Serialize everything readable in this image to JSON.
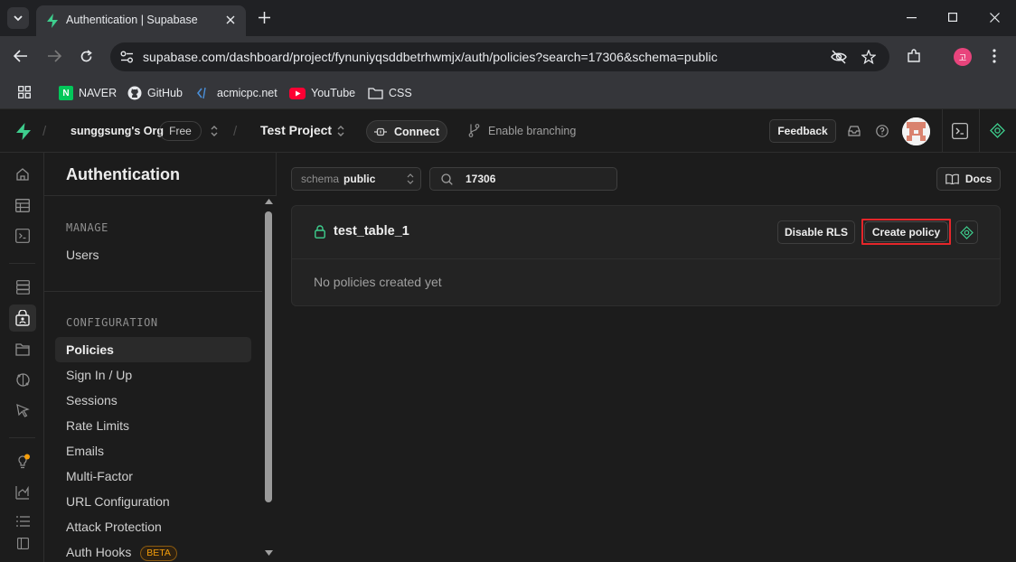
{
  "browser": {
    "tab_title": "Authentication | Supabase",
    "url": "supabase.com/dashboard/project/fynuniyqsddbetrhwmjx/auth/policies?search=17306&schema=public",
    "profile_initial": "고",
    "bookmarks": [
      {
        "label": "NAVER",
        "icon": "naver-icon"
      },
      {
        "label": "GitHub",
        "icon": "github-icon"
      },
      {
        "label": "acmicpc.net",
        "icon": "code-icon"
      },
      {
        "label": "YouTube",
        "icon": "youtube-icon"
      },
      {
        "label": "CSS",
        "icon": "folder-icon"
      }
    ]
  },
  "header": {
    "org_name": "sunggsung's Org",
    "org_plan": "Free",
    "project_name": "Test Project",
    "connect_label": "Connect",
    "branching_label": "Enable branching",
    "feedback_label": "Feedback"
  },
  "menu": {
    "title": "Authentication",
    "sections": [
      {
        "title": "MANAGE",
        "items": [
          {
            "label": "Users"
          }
        ]
      },
      {
        "title": "CONFIGURATION",
        "items": [
          {
            "label": "Policies",
            "active": true
          },
          {
            "label": "Sign In / Up"
          },
          {
            "label": "Sessions"
          },
          {
            "label": "Rate Limits"
          },
          {
            "label": "Emails"
          },
          {
            "label": "Multi-Factor"
          },
          {
            "label": "URL Configuration"
          },
          {
            "label": "Attack Protection"
          },
          {
            "label": "Auth Hooks",
            "badge": "BETA"
          }
        ]
      }
    ]
  },
  "toolbar": {
    "schema_prefix": "schema",
    "schema_value": "public",
    "search_value": "17306",
    "docs_label": "Docs"
  },
  "table_card": {
    "table_name": "test_table_1",
    "disable_rls_label": "Disable RLS",
    "create_policy_label": "Create policy",
    "empty_message": "No policies created yet"
  },
  "colors": {
    "brand": "#3ecf8e",
    "highlight_border": "#e5262a",
    "beta_badge": "#f59e0b"
  }
}
